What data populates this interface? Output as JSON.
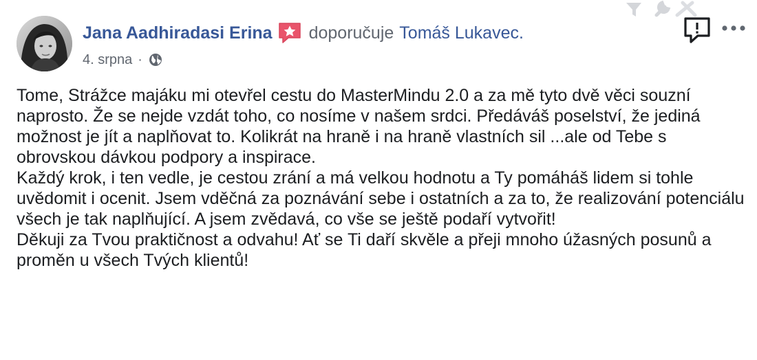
{
  "post": {
    "author": "Jana Aadhiradasi Erina",
    "action": "doporučuje",
    "page": "Tomáš Lukavec.",
    "date": "4. srpna",
    "separator": "·",
    "audience_icon": "globe-icon",
    "recommend_icon": "recommend-star-icon",
    "report_icon": "report-icon",
    "more_icon": "more-options-icon",
    "paragraphs": [
      "Tome, Strážce majáku mi otevřel cestu do MasterMindu 2.0 a za mě tyto dvě věci souzní naprosto. Že se nejde vzdát toho, co nosíme v našem srdci. Předáváš poselství, že jediná možnost je jít a naplňovat to. Kolikrát na hraně i na hraně vlastních sil ...ale od Tebe s obrovskou dávkou podpory a inspirace.",
      "Každý krok, i ten vedle, je cestou zrání a má velkou hodnotu a Ty pomáháš lidem si tohle uvědomit i ocenit. Jsem vděčná za poznávání sebe i ostatních a za to, že realizování potenciálu všech je tak naplňující. A jsem zvědavá, co vše se ještě podaří vytvořit!",
      "Děkuji za Tvou praktičnost a odvahu! Ať se Ti daří skvěle a přeji mnoho úžasných posunů a proměn u všech Tvých klientů!"
    ]
  },
  "colors": {
    "link": "#385898",
    "secondary_text": "#616770",
    "body_text": "#1c1e21",
    "recommend_badge": "#e9546b"
  }
}
